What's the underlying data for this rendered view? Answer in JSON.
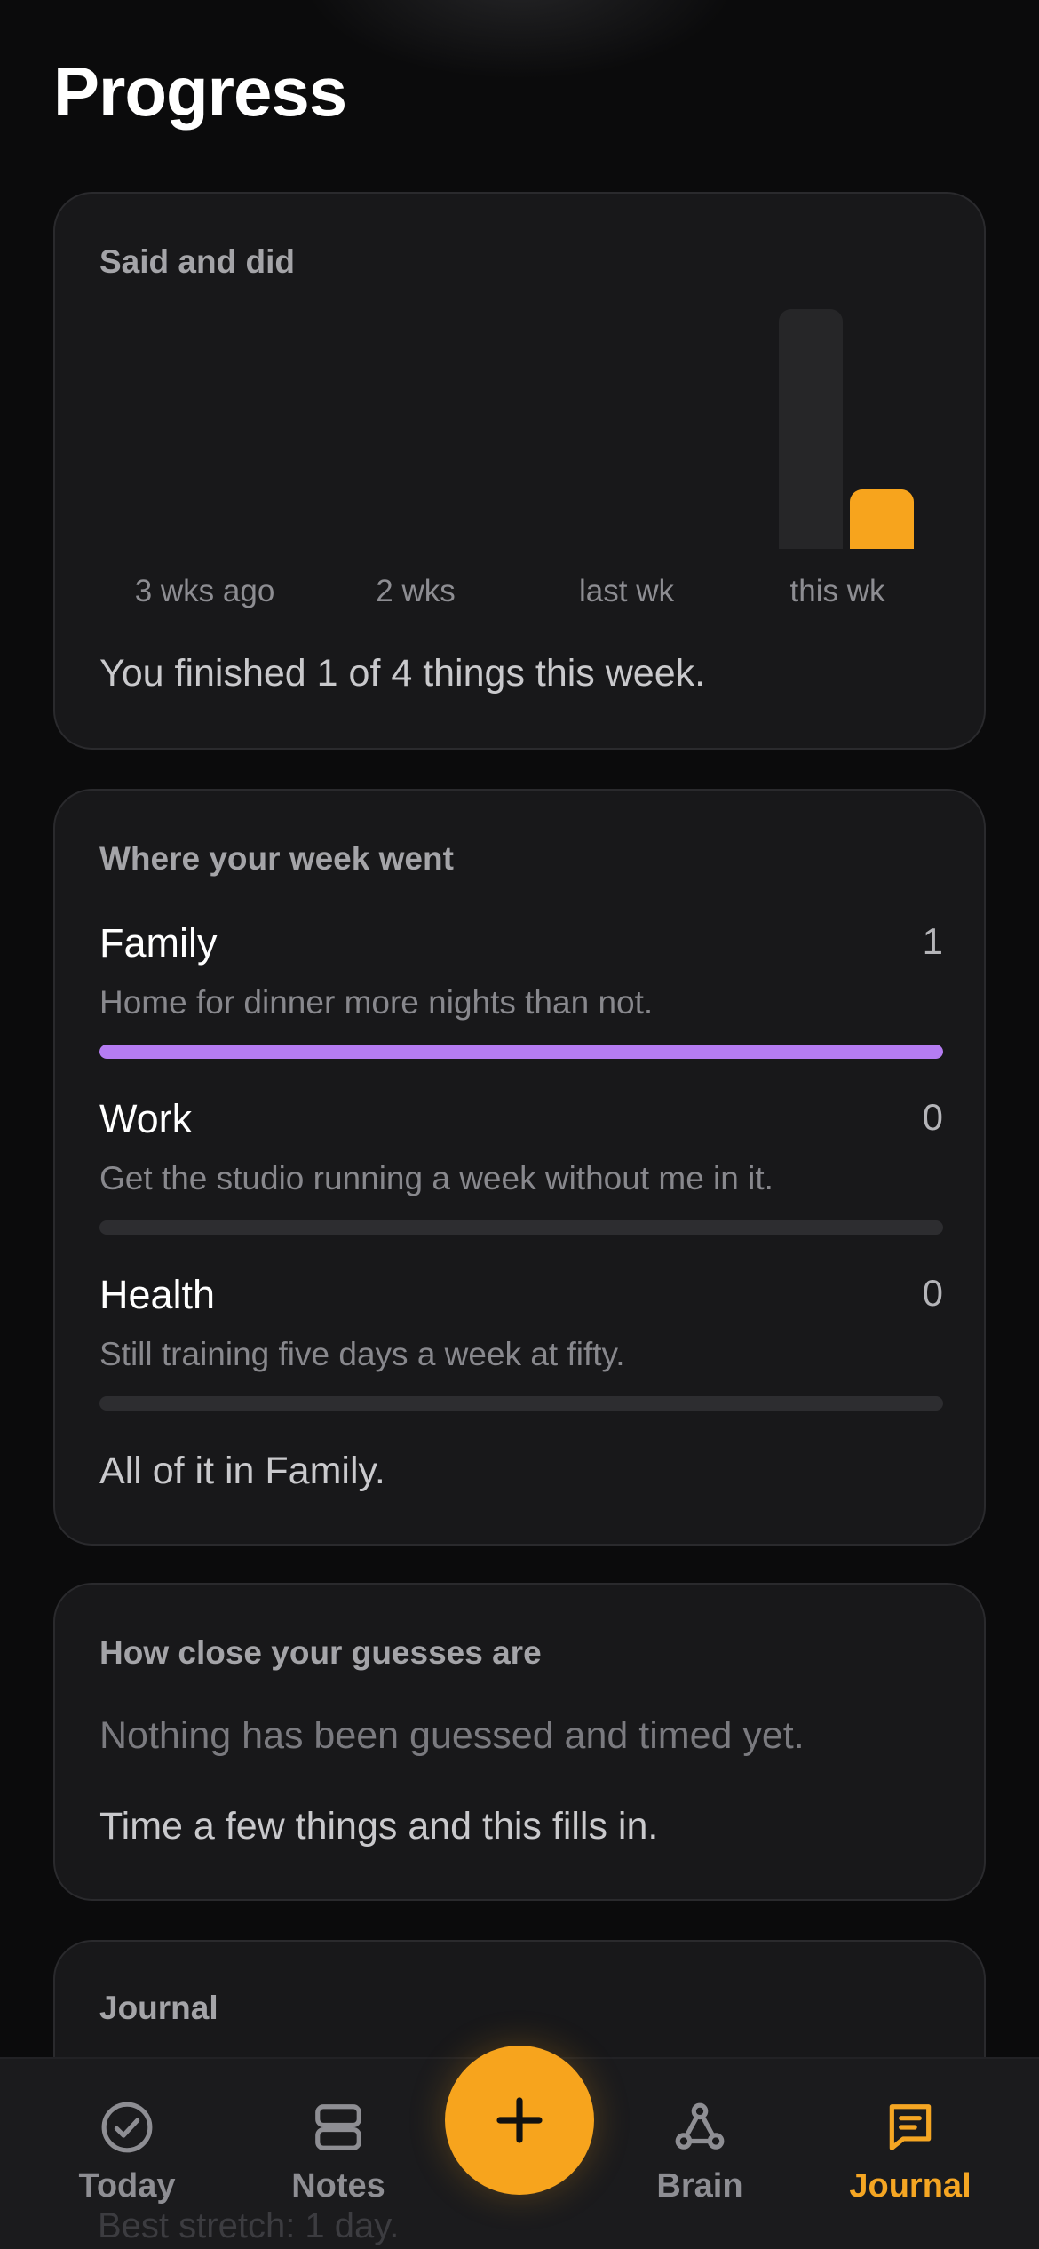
{
  "page": {
    "title": "Progress"
  },
  "said_and_did": {
    "label": "Said and did",
    "summary": "You finished 1 of 4 things this week.",
    "chart_data": {
      "type": "bar",
      "categories": [
        "3 wks ago",
        "2 wks",
        "last wk",
        "this wk"
      ],
      "series": [
        {
          "values": [
            0,
            0,
            0,
            4
          ]
        },
        {
          "values": [
            0,
            0,
            0,
            1
          ]
        }
      ],
      "ylim": [
        0,
        4
      ],
      "colors": [
        "#262628",
        "#f7a41d"
      ]
    }
  },
  "week": {
    "label": "Where your week went",
    "categories": [
      {
        "name": "Family",
        "count": "1",
        "desc": "Home for dinner more nights than not.",
        "fill": 1.0,
        "color": "#b57cf2"
      },
      {
        "name": "Work",
        "count": "0",
        "desc": "Get the studio running a week without me in it.",
        "fill": 0,
        "color": "#b57cf2"
      },
      {
        "name": "Health",
        "count": "0",
        "desc": "Still training five days a week at fifty.",
        "fill": 0,
        "color": "#b57cf2"
      }
    ],
    "summary": "All of it in Family."
  },
  "guesses": {
    "label": "How close your guesses are",
    "empty": "Nothing has been guessed and timed yet.",
    "hint": "Time a few things and this fills in."
  },
  "journal": {
    "label": "Journal",
    "partial": "Best stretch: 1 day."
  },
  "tabbar": {
    "today": {
      "label": "Today",
      "icon": "check-circle-icon"
    },
    "notes": {
      "label": "Notes",
      "icon": "stack-icon"
    },
    "add": {
      "icon": "plus-icon"
    },
    "brain": {
      "label": "Brain",
      "icon": "network-icon"
    },
    "journal": {
      "label": "Journal",
      "icon": "journal-icon"
    },
    "accent": "#f5a623"
  }
}
